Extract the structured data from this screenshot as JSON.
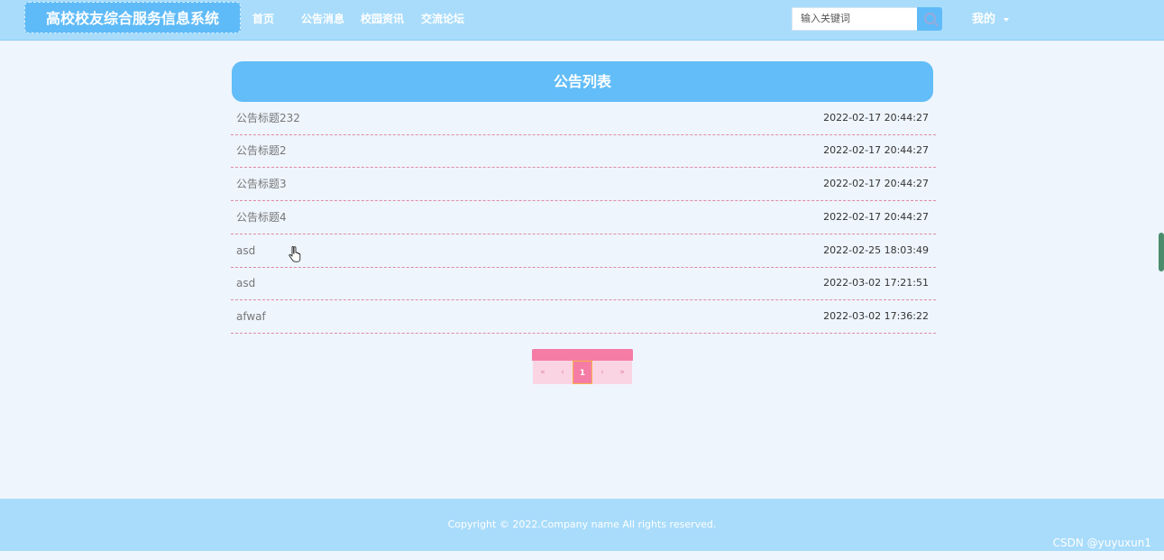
{
  "header": {
    "brand": "高校校友综合服务信息系统",
    "nav": [
      "首页",
      "公告消息",
      "校园资讯",
      "交流论坛"
    ],
    "search_placeholder": "输入关键词",
    "user_menu": "我的"
  },
  "main": {
    "title": "公告列表",
    "items": [
      {
        "title": "公告标题232",
        "time": "2022-02-17 20:44:27"
      },
      {
        "title": "公告标题2",
        "time": "2022-02-17 20:44:27"
      },
      {
        "title": "公告标题3",
        "time": "2022-02-17 20:44:27"
      },
      {
        "title": "公告标题4",
        "time": "2022-02-17 20:44:27"
      },
      {
        "title": "asd",
        "time": "2022-02-25 18:03:49"
      },
      {
        "title": "asd",
        "time": "2022-03-02 17:21:51"
      },
      {
        "title": "afwaf",
        "time": "2022-03-02 17:36:22"
      }
    ],
    "pagination": {
      "first": "«",
      "prev": "‹",
      "current": "1",
      "next": "›",
      "last": "»"
    }
  },
  "footer": {
    "copyright": "Copyright © 2022.Company name All rights reserved."
  },
  "watermark": "CSDN @yuyuxun1",
  "colors": {
    "header_bg": "#a9dcfb",
    "accent_blue": "#62bdf8",
    "accent_pink": "#f57ca4",
    "page_bg": "#eef5fd"
  }
}
